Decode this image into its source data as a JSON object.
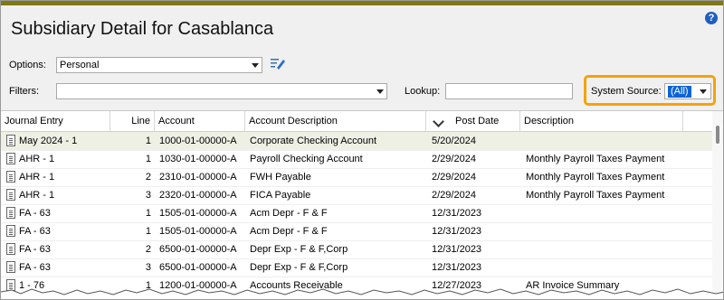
{
  "title": "Subsidiary Detail for Casablanca",
  "help_label": "?",
  "options": {
    "label": "Options:",
    "value": "Personal"
  },
  "filters": {
    "label": "Filters:",
    "value": ""
  },
  "lookup": {
    "label": "Lookup:",
    "value": ""
  },
  "system_source": {
    "label": "System Source:",
    "value": "(All)"
  },
  "columns": [
    "Journal Entry",
    "Line",
    "Account",
    "Account Description",
    "Post Date",
    "Description"
  ],
  "rows": [
    {
      "journal": "May 2024 - 1",
      "line": "1",
      "account": "1000-01-00000-A",
      "acct_desc": "Corporate Checking Account",
      "post_date": "5/20/2024",
      "description": ""
    },
    {
      "journal": "AHR - 1",
      "line": "1",
      "account": "1030-01-00000-A",
      "acct_desc": "Payroll Checking Account",
      "post_date": "2/29/2024",
      "description": "Monthly Payroll Taxes Payment"
    },
    {
      "journal": "AHR - 1",
      "line": "2",
      "account": "2310-01-00000-A",
      "acct_desc": "FWH Payable",
      "post_date": "2/29/2024",
      "description": "Monthly Payroll Taxes Payment"
    },
    {
      "journal": "AHR - 1",
      "line": "3",
      "account": "2320-01-00000-A",
      "acct_desc": "FICA Payable",
      "post_date": "2/29/2024",
      "description": "Monthly Payroll Taxes Payment"
    },
    {
      "journal": "FA - 63",
      "line": "1",
      "account": "1505-01-00000-A",
      "acct_desc": "Acm Depr - F & F",
      "post_date": "12/31/2023",
      "description": ""
    },
    {
      "journal": "FA - 63",
      "line": "1",
      "account": "1505-01-00000-A",
      "acct_desc": "Acm Depr - F & F",
      "post_date": "12/31/2023",
      "description": ""
    },
    {
      "journal": "FA - 63",
      "line": "2",
      "account": "6500-01-00000-A",
      "acct_desc": "Depr Exp - F & F,Corp",
      "post_date": "12/31/2023",
      "description": ""
    },
    {
      "journal": "FA - 63",
      "line": "3",
      "account": "6500-01-00000-A",
      "acct_desc": "Depr Exp - F & F,Corp",
      "post_date": "12/31/2023",
      "description": ""
    },
    {
      "journal": "1 - 76",
      "line": "1",
      "account": "1200-01-00000-A",
      "acct_desc": "Accounts Receivable",
      "post_date": "12/27/2023",
      "description": "AR Invoice Summary"
    }
  ],
  "colors": {
    "top_bar": "#7f7a14",
    "highlight": "#f5a300",
    "selected_row": "#eef0e4"
  }
}
